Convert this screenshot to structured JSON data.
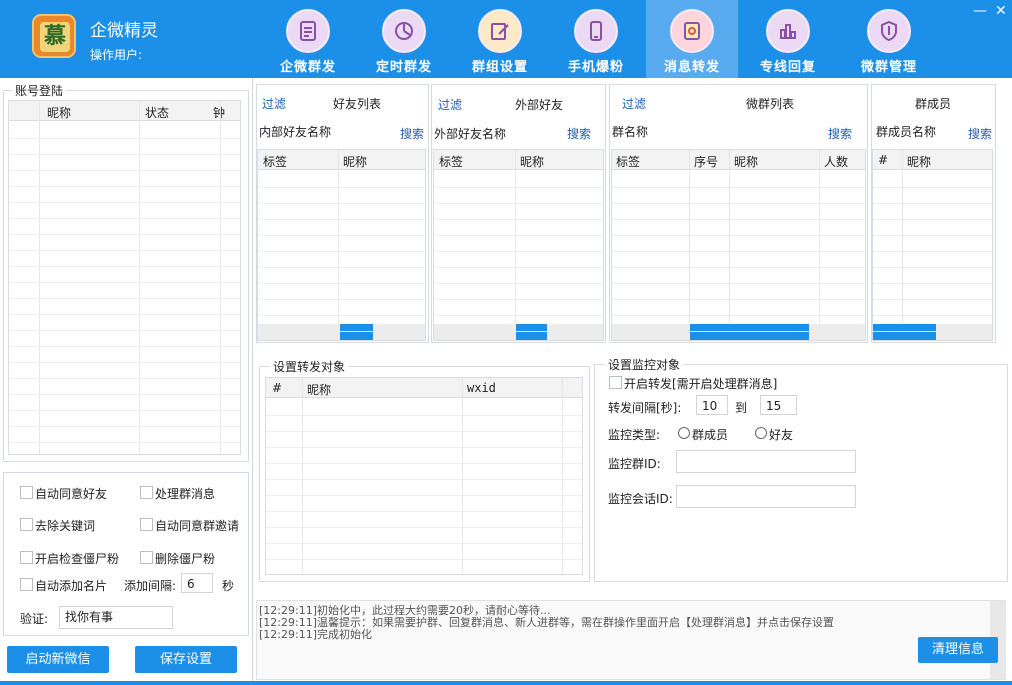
{
  "app": {
    "title": "企微精灵",
    "user_label": "操作用户:",
    "logo_char": "慕"
  },
  "nav": [
    {
      "label": "企微群发",
      "icon": "document-list-icon"
    },
    {
      "label": "定时群发",
      "icon": "pie-clock-icon"
    },
    {
      "label": "群组设置",
      "icon": "edit-note-icon"
    },
    {
      "label": "手机爆粉",
      "icon": "phone-icon"
    },
    {
      "label": "消息转发",
      "icon": "message-forward-icon",
      "active": true
    },
    {
      "label": "专线回复",
      "icon": "bar-chart-icon"
    },
    {
      "label": "微群管理",
      "icon": "shield-icon"
    }
  ],
  "window": {
    "minimize": "—",
    "close": "✕"
  },
  "account": {
    "title": "账号登陆",
    "columns": [
      "昵称",
      "状态",
      "钟"
    ]
  },
  "friends": {
    "filter": "过滤",
    "title": "好友列表",
    "search_label": "内部好友名称",
    "search": "搜索",
    "columns": [
      "标签",
      "昵称"
    ]
  },
  "external": {
    "filter": "过滤",
    "title": "外部好友",
    "search_label": "外部好友名称",
    "search": "搜索",
    "columns": [
      "标签",
      "昵称"
    ]
  },
  "groups": {
    "filter": "过滤",
    "title": "微群列表",
    "search_label": "群名称",
    "search": "搜索",
    "columns": [
      "标签",
      "序号",
      "昵称",
      "人数"
    ]
  },
  "members": {
    "title": "群成员",
    "search_label": "群成员名称",
    "search": "搜索",
    "columns": [
      "#",
      "昵称"
    ]
  },
  "forward": {
    "title": "设置转发对象",
    "columns": [
      "#",
      "昵称",
      "wxid"
    ]
  },
  "monitor": {
    "title": "设置监控对象",
    "enable_label": "开启转发[需开启处理群消息]",
    "interval_label": "转发间隔[秒]:",
    "interval_from": "10",
    "to_label": "到",
    "interval_to": "15",
    "type_label": "监控类型:",
    "type_options": [
      "群成员",
      "好友"
    ],
    "group_id_label": "监控群ID:",
    "session_id_label": "监控会话ID:"
  },
  "options": {
    "auto_accept": "自动同意好友",
    "process_group": "处理群消息",
    "remove_keyword": "去除关键词",
    "auto_group_invite": "自动同意群邀请",
    "check_zombie": "开启检查僵尸粉",
    "delete_zombie": "删除僵尸粉",
    "auto_add_card": "自动添加名片",
    "add_interval_label": "添加间隔:",
    "add_interval": "6",
    "seconds": "秒",
    "verify_label": "验证:",
    "verify_value": "找你有事"
  },
  "buttons": {
    "start_wechat": "启动新微信",
    "save_settings": "保存设置",
    "clear_info": "清理信息"
  },
  "log": [
    "[12:29:11]初始化中，此过程大约需要20秒，请耐心等待...",
    "[12:29:11]温馨提示：如果需要护群、回复群消息、新人进群等，需在群操作里面开启【处理群消息】并点击保存设置",
    "[12:29:11]完成初始化"
  ],
  "colors": {
    "accent": "#1c8fe8",
    "link": "#1a5fb4"
  }
}
